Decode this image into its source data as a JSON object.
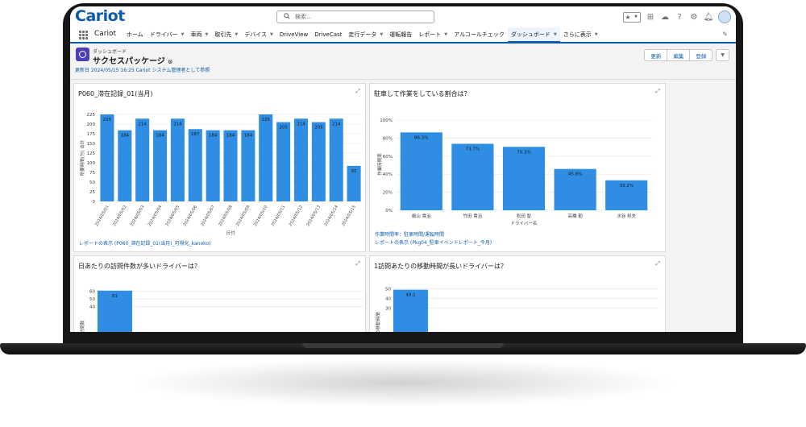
{
  "header": {
    "logo": "Cariot",
    "search_placeholder": "検索..."
  },
  "nav": {
    "app_name": "Cariot",
    "items": [
      {
        "label": "ホーム",
        "chevron": false
      },
      {
        "label": "ドライバー",
        "chevron": true
      },
      {
        "label": "車両",
        "chevron": true
      },
      {
        "label": "取引先",
        "chevron": true
      },
      {
        "label": "デバイス",
        "chevron": true
      },
      {
        "label": "DriveView",
        "chevron": false
      },
      {
        "label": "DriveCast",
        "chevron": false
      },
      {
        "label": "走行データ",
        "chevron": true
      },
      {
        "label": "運転報告",
        "chevron": false
      },
      {
        "label": "レポート",
        "chevron": true
      },
      {
        "label": "アルコールチェック",
        "chevron": false
      },
      {
        "label": "ダッシュボード",
        "chevron": true,
        "active": true
      },
      {
        "label": "さらに表示",
        "chevron": true
      }
    ]
  },
  "dashboard": {
    "kicker": "ダッシュボード",
    "title": "サクセスパッケージ",
    "updated": "更新日 2024/05/15 16:25 Cariot システム管理者として参照",
    "buttons": {
      "refresh": "更新",
      "edit": "編集",
      "subscribe": "登録"
    }
  },
  "panels": {
    "p1": {
      "title": "P060_滞在記録_01(当月)",
      "footer": "レポートの表示 (P060_滞在記録_01(当月)_可視化_kaneko)"
    },
    "p2": {
      "title": "駐車して作業をしている割合は？",
      "footer1": "作業時間率：駐車時間/運転時間",
      "footer2": "レポートの表示 (Pkg04_駐車イベントレポート_今月)"
    },
    "p3": {
      "title": "日あたりの訪問件数が多いドライバーは？"
    },
    "p4": {
      "title": "1訪問あたりの移動時間が長いドライバーは？"
    }
  },
  "chart_data": [
    {
      "type": "bar",
      "title": "P060_滞在記録_01(当月)",
      "xlabel": "日付",
      "ylabel": "所要時間(分) 合計",
      "categories": [
        "2024/05/01",
        "2024/05/02",
        "2024/05/03",
        "2024/05/04",
        "2024/05/05",
        "2024/05/06",
        "2024/05/07",
        "2024/05/08",
        "2024/05/09",
        "2024/05/10",
        "2024/05/11",
        "2024/05/12",
        "2024/05/13",
        "2024/05/14",
        "2024/05/15"
      ],
      "values": [
        225,
        184,
        214,
        184,
        214,
        187,
        184,
        184,
        184,
        225,
        205,
        214,
        205,
        214,
        92
      ],
      "ylim": [
        0,
        250
      ],
      "yticks": [
        0,
        25,
        50,
        75,
        100,
        125,
        150,
        175,
        200,
        225
      ]
    },
    {
      "type": "bar",
      "title": "駐車して作業をしている割合は？",
      "xlabel": "ドライバー名",
      "ylabel": "作業時間率",
      "categories": [
        "嶋山 貴治",
        "竹田 貴治",
        "松田 智",
        "高橋 勤",
        "水谷 邦夫"
      ],
      "values": [
        86.3,
        73.7,
        70.3,
        45.8,
        33.2
      ],
      "labels": [
        "86.3%",
        "73.7%",
        "70.3%",
        "45.8%",
        "33.2%"
      ],
      "ylim": [
        0,
        100
      ],
      "yticks": [
        0,
        20,
        40,
        60,
        80,
        100
      ],
      "ytick_labels": [
        "0%",
        "20%",
        "40%",
        "60%",
        "80%",
        "100%"
      ]
    },
    {
      "type": "bar",
      "title": "日あたりの訪問件数が多いドライバーは？",
      "ylabel": "訪問数",
      "values": [
        61
      ],
      "ylim": [
        0,
        65
      ],
      "yticks": [
        40,
        50,
        60
      ]
    },
    {
      "type": "bar",
      "title": "1訪問あたりの移動時間が長いドライバーは？",
      "ylabel": "の移動時間",
      "values": [
        49.1
      ],
      "ylim": [
        0,
        53
      ],
      "yticks": [
        30,
        40,
        50
      ]
    }
  ]
}
